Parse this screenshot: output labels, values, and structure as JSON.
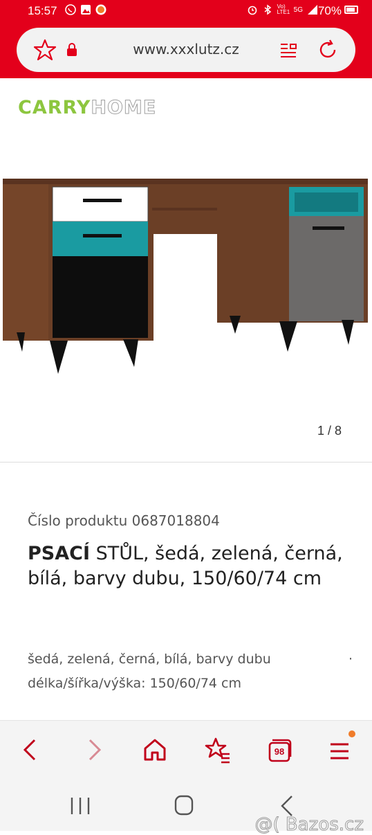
{
  "status_bar": {
    "time": "15:57",
    "battery": "70%",
    "network_label": "5G",
    "carrier_label": "Vo) LTE1"
  },
  "browser": {
    "url": "www.xxxlutz.cz",
    "tab_count": "98"
  },
  "brand": {
    "part1": "CARRY",
    "part2": "HOME"
  },
  "gallery": {
    "counter": "1 / 8"
  },
  "product": {
    "number_label": "Číslo produktu 0687018804",
    "title_bold": "PSACÍ",
    "title_rest": " STŮL, šedá, zelená, černá, bílá, barvy dubu, 150/60/74 cm",
    "desc_line1": "šedá, zelená, černá, bílá, barvy dubu",
    "desc_dot": "·",
    "desc_line2": "délka/šířka/výška: 150/60/74 cm"
  },
  "watermark": {
    "text": "@( Bazos.cz"
  },
  "colors": {
    "brand_red": "#e3001b",
    "logo_green": "#8dc63f",
    "wood": "#6b3f26",
    "teal": "#1a9ba1",
    "grey_door": "#6c6a69",
    "notification_dot": "#f07c2a"
  }
}
